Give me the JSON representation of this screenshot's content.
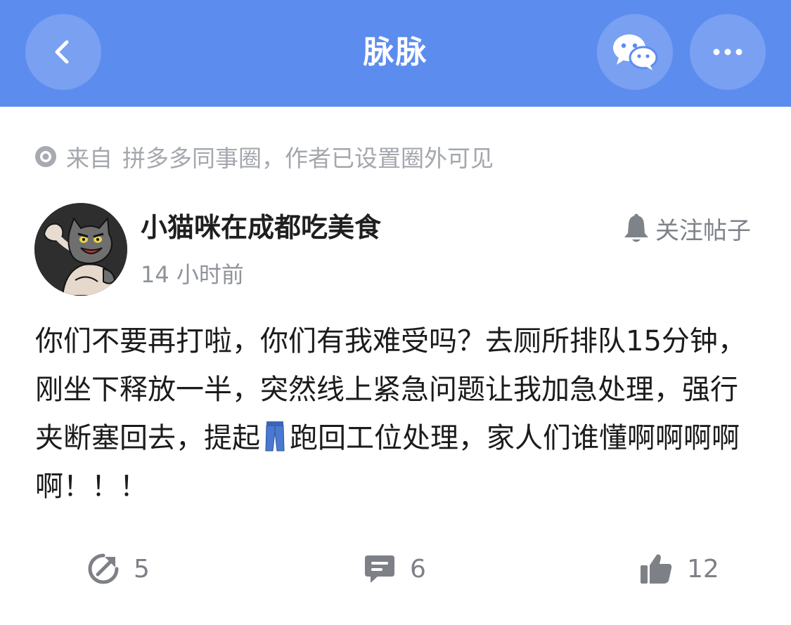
{
  "header": {
    "title": "脉脉",
    "background_color": "#5d8cef",
    "back_icon": "chevron-left-icon",
    "wechat_icon": "wechat-icon",
    "more_icon": "more-dots-icon"
  },
  "source": {
    "prefix": "来自",
    "text": "拼多多同事圈，作者已设置圈外可见",
    "icon": "radio-dot-icon"
  },
  "author": {
    "name": "小猫咪在成都吃美食",
    "time": "14 小时前",
    "avatar": "cartoon-cat-avatar"
  },
  "follow": {
    "label": "关注帖子",
    "icon": "bell-icon"
  },
  "post": {
    "text_before_emoji": "你们不要再打啦，你们有我难受吗？去厕所排队15分钟，刚坐下释放一半，突然线上紧急问题让我加急处理，强行夹断塞回去，提起",
    "emoji": "jeans-icon",
    "text_after_emoji": "跑回工位处理，家人们谁懂啊啊啊啊啊！！！"
  },
  "actions": {
    "share_count": "5",
    "comment_count": "6",
    "like_count": "12",
    "share_icon": "share-arrow-icon",
    "comment_icon": "comment-bubble-icon",
    "like_icon": "thumbs-up-icon"
  }
}
